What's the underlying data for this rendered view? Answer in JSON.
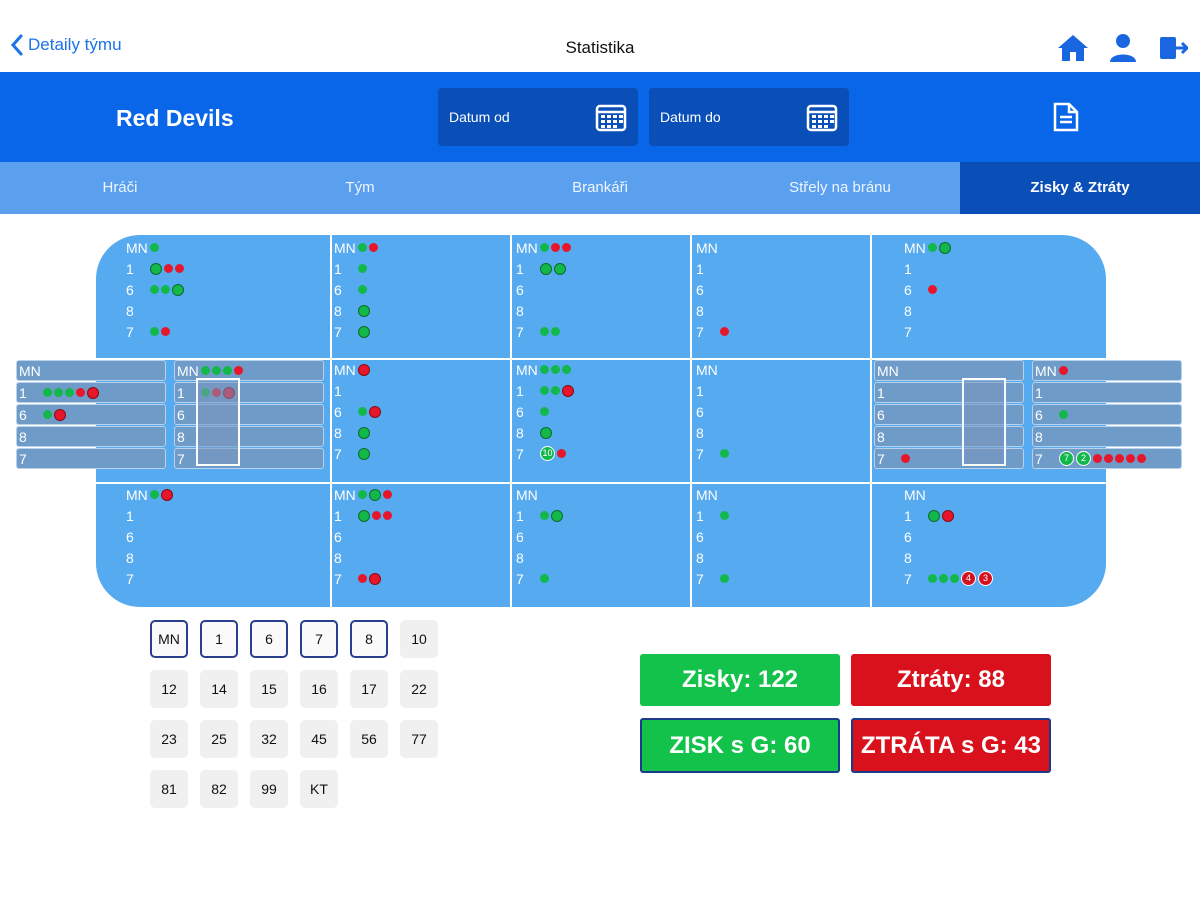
{
  "nav": {
    "back_label": "Detaily týmu",
    "title": "Statistika",
    "icons": [
      "home-icon",
      "user-icon",
      "logout-icon"
    ]
  },
  "header": {
    "team_name": "Red Devils",
    "date_from": "Datum od",
    "date_to": "Datum do",
    "doc_icon": "document-icon"
  },
  "tabs": [
    {
      "label": "Hráči"
    },
    {
      "label": "Tým"
    },
    {
      "label": "Brankáři"
    },
    {
      "label": "Střely na bránu"
    },
    {
      "label": "Zisky & Ztráty",
      "active": true
    }
  ],
  "zones": [
    {
      "zone": "top-1",
      "rows": [
        [
          "MN",
          "g"
        ],
        [
          "1",
          "Grr"
        ],
        [
          "6",
          "ggG"
        ],
        [
          "8",
          ""
        ],
        [
          "7",
          "gr"
        ]
      ]
    },
    {
      "zone": "top-2",
      "rows": [
        [
          "MN",
          "gr"
        ],
        [
          "1",
          "g"
        ],
        [
          "6",
          "g"
        ],
        [
          "8",
          "G"
        ],
        [
          "7",
          "G"
        ]
      ]
    },
    {
      "zone": "top-3",
      "rows": [
        [
          "MN",
          "grr"
        ],
        [
          "1",
          "GG"
        ],
        [
          "6",
          ""
        ],
        [
          "8",
          ""
        ],
        [
          "7",
          "gg"
        ]
      ]
    },
    {
      "zone": "top-4",
      "rows": [
        [
          "MN",
          ""
        ],
        [
          "1",
          ""
        ],
        [
          "6",
          ""
        ],
        [
          "8",
          ""
        ],
        [
          "7",
          "r"
        ]
      ]
    },
    {
      "zone": "top-5",
      "rows": [
        [
          "MN",
          "gG"
        ],
        [
          "1",
          ""
        ],
        [
          "6",
          "r"
        ],
        [
          "8",
          ""
        ],
        [
          "7",
          ""
        ]
      ]
    },
    {
      "zone": "mid-2",
      "rows": [
        [
          "MN",
          "R"
        ],
        [
          "1",
          ""
        ],
        [
          "6",
          "gR"
        ],
        [
          "8",
          "G"
        ],
        [
          "7",
          "G"
        ]
      ]
    },
    {
      "zone": "mid-3",
      "rows": [
        [
          "MN",
          "ggg"
        ],
        [
          "1",
          "ggR"
        ],
        [
          "6",
          "g"
        ],
        [
          "8",
          "G"
        ],
        [
          "7",
          "#10r"
        ]
      ]
    },
    {
      "zone": "mid-4",
      "rows": [
        [
          "MN",
          ""
        ],
        [
          "1",
          ""
        ],
        [
          "6",
          ""
        ],
        [
          "8",
          ""
        ],
        [
          "7",
          "g"
        ]
      ]
    },
    {
      "zone": "bot-1",
      "rows": [
        [
          "MN",
          "gR"
        ],
        [
          "1",
          ""
        ],
        [
          "6",
          ""
        ],
        [
          "8",
          ""
        ],
        [
          "7",
          ""
        ]
      ]
    },
    {
      "zone": "bot-2",
      "rows": [
        [
          "MN",
          "gGr"
        ],
        [
          "1",
          "Grr"
        ],
        [
          "6",
          ""
        ],
        [
          "8",
          ""
        ],
        [
          "7",
          "rR"
        ]
      ]
    },
    {
      "zone": "bot-3",
      "rows": [
        [
          "MN",
          ""
        ],
        [
          "1",
          "gG"
        ],
        [
          "6",
          ""
        ],
        [
          "8",
          ""
        ],
        [
          "7",
          "g"
        ]
      ]
    },
    {
      "zone": "bot-4",
      "rows": [
        [
          "MN",
          ""
        ],
        [
          "1",
          "g"
        ],
        [
          "6",
          ""
        ],
        [
          "8",
          ""
        ],
        [
          "7",
          "g"
        ]
      ]
    },
    {
      "zone": "bot-5",
      "rows": [
        [
          "MN",
          ""
        ],
        [
          "1",
          "GR"
        ],
        [
          "6",
          ""
        ],
        [
          "8",
          ""
        ],
        [
          "7",
          "ggg$4$3"
        ]
      ]
    }
  ],
  "goal_boxes": [
    {
      "zone": "left-outer",
      "rows": [
        [
          "MN",
          ""
        ],
        [
          "1",
          "gggrR"
        ],
        [
          "6",
          "gR"
        ],
        [
          "8",
          ""
        ],
        [
          "7",
          ""
        ]
      ]
    },
    {
      "zone": "left-inner",
      "rows": [
        [
          "MN",
          "gggr"
        ],
        [
          "1",
          "grR"
        ],
        [
          "6",
          ""
        ],
        [
          "8",
          ""
        ],
        [
          "7",
          ""
        ]
      ]
    },
    {
      "zone": "right-inner",
      "rows": [
        [
          "MN",
          ""
        ],
        [
          "1",
          ""
        ],
        [
          "6",
          ""
        ],
        [
          "8",
          ""
        ],
        [
          "7",
          "r"
        ]
      ]
    },
    {
      "zone": "right-outer",
      "rows": [
        [
          "MN",
          "r"
        ],
        [
          "1",
          ""
        ],
        [
          "6",
          "g"
        ],
        [
          "8",
          ""
        ],
        [
          "7",
          "#7#2rrrrr"
        ]
      ]
    }
  ],
  "numbers": [
    {
      "label": "MN",
      "selected": true
    },
    {
      "label": "1",
      "selected": true
    },
    {
      "label": "6",
      "selected": true
    },
    {
      "label": "7",
      "selected": true
    },
    {
      "label": "8",
      "selected": true
    },
    {
      "label": "10"
    },
    {
      "label": "12"
    },
    {
      "label": "14"
    },
    {
      "label": "15"
    },
    {
      "label": "16"
    },
    {
      "label": "17"
    },
    {
      "label": "22"
    },
    {
      "label": "23"
    },
    {
      "label": "25"
    },
    {
      "label": "32"
    },
    {
      "label": "45"
    },
    {
      "label": "56"
    },
    {
      "label": "77"
    },
    {
      "label": "81"
    },
    {
      "label": "82"
    },
    {
      "label": "99"
    },
    {
      "label": "KT"
    }
  ],
  "summary": {
    "gains": "Zisky: 122",
    "losses": "Ztráty: 88",
    "gains_g": "ZISK s G: 60",
    "losses_g": "ZTRÁTA s G: 43"
  },
  "colors": {
    "primary": "#0a66e8",
    "dark": "#0a4fb8",
    "rink": "#55aaf0",
    "gain": "#12c24a",
    "loss": "#d9111c"
  }
}
